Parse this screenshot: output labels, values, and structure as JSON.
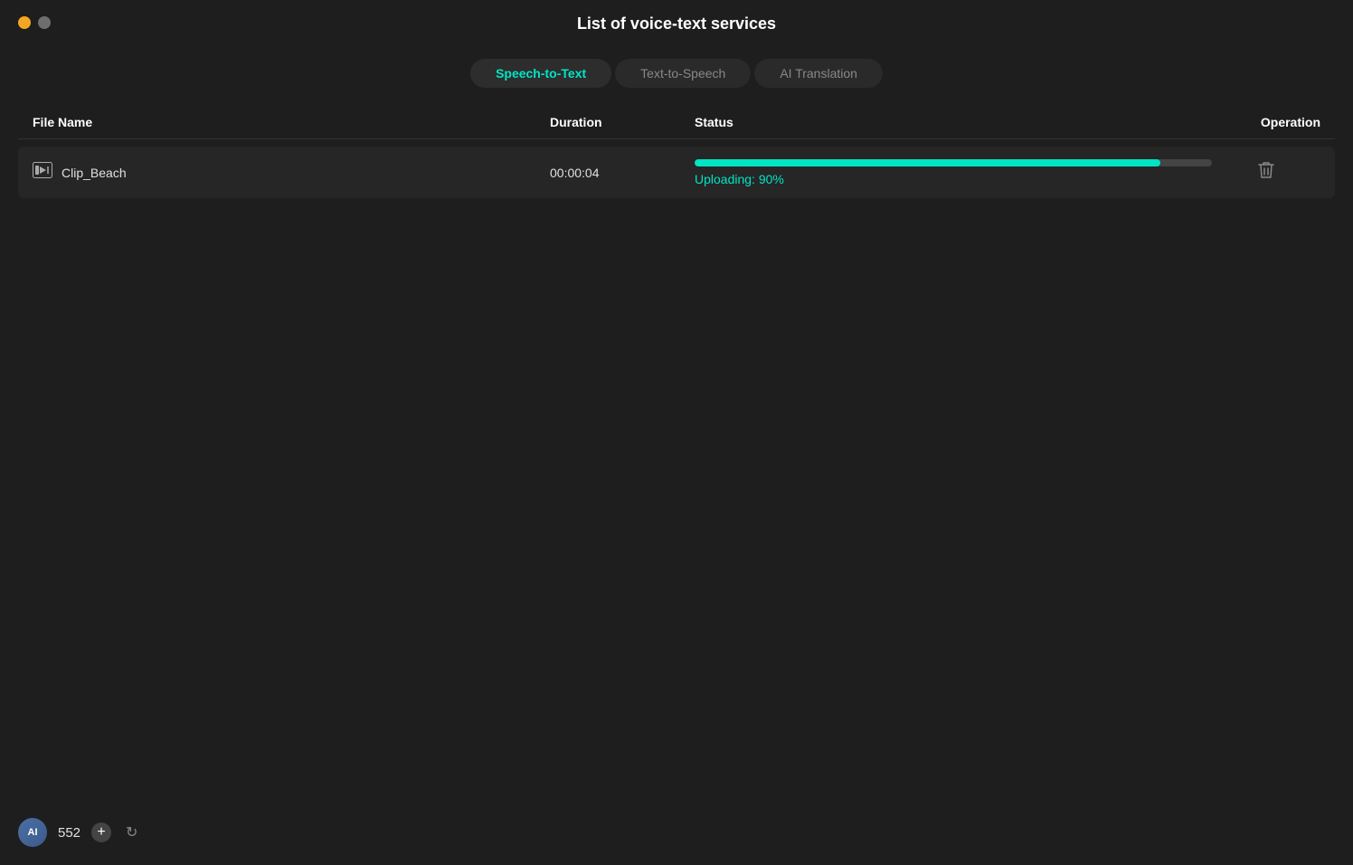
{
  "window": {
    "title": "List of voice-text services"
  },
  "windowControls": {
    "close_color": "#f5a623",
    "minimize_color": "#6e6e6e"
  },
  "tabs": [
    {
      "id": "speech-to-text",
      "label": "Speech-to-Text",
      "active": true
    },
    {
      "id": "text-to-speech",
      "label": "Text-to-Speech",
      "active": false
    },
    {
      "id": "ai-translation",
      "label": "AI Translation",
      "active": false
    }
  ],
  "table": {
    "columns": {
      "fileName": "File Name",
      "duration": "Duration",
      "status": "Status",
      "operation": "Operation"
    },
    "rows": [
      {
        "fileName": "Clip_Beach",
        "duration": "00:00:04",
        "statusText": "Uploading:  90%",
        "progressPercent": 90
      }
    ]
  },
  "bottomBar": {
    "aiLabel": "AI",
    "credits": "552",
    "addLabel": "+",
    "refreshIcon": "↻"
  }
}
